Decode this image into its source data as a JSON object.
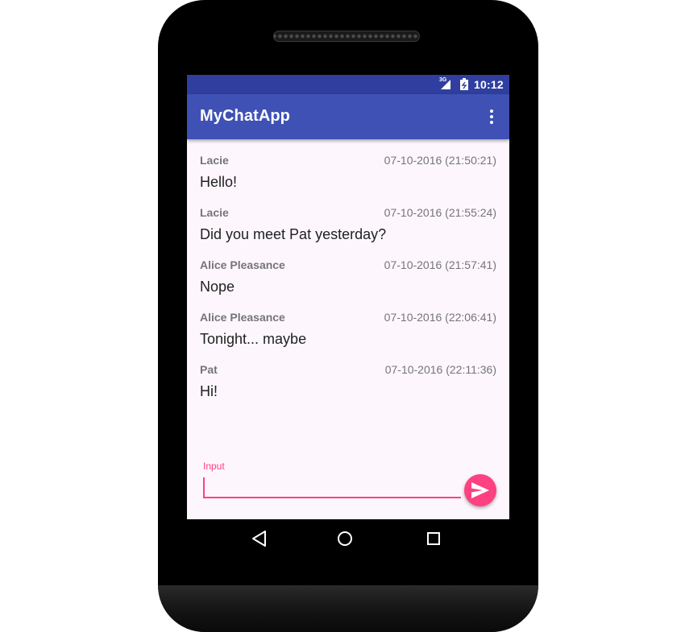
{
  "statusbar": {
    "network": "3G",
    "time": "10:12"
  },
  "appbar": {
    "title": "MyChatApp",
    "menu_icon": "more-vert-icon"
  },
  "messages": [
    {
      "author": "Lacie",
      "time": "07-10-2016 (21:50:21)",
      "text": "Hello!"
    },
    {
      "author": "Lacie",
      "time": "07-10-2016 (21:55:24)",
      "text": "Did you meet Pat yesterday?"
    },
    {
      "author": "Alice Pleasance",
      "time": "07-10-2016 (21:57:41)",
      "text": "Nope"
    },
    {
      "author": "Alice Pleasance",
      "time": "07-10-2016 (22:06:41)",
      "text": "Tonight... maybe"
    },
    {
      "author": "Pat",
      "time": "07-10-2016 (22:11:36)",
      "text": "Hi!"
    }
  ],
  "input": {
    "label": "Input",
    "value": ""
  },
  "send_icon": "send-icon",
  "navigation": {
    "back_icon": "back-triangle-icon",
    "home_icon": "home-circle-icon",
    "recents_icon": "recents-square-icon"
  },
  "colors": {
    "primary": "#3f51b5",
    "primary_dark": "#303f9f",
    "accent": "#ff4081",
    "background": "#fdf7fd"
  }
}
